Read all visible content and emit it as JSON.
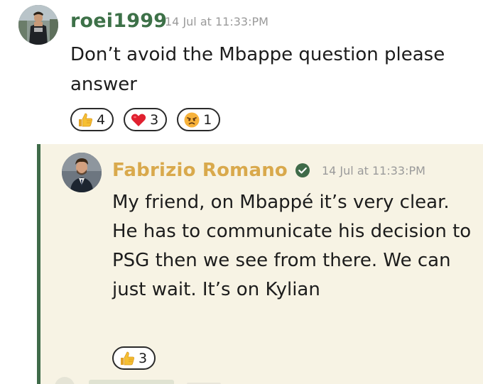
{
  "comment": {
    "username": "roei1999",
    "timestamp": "14 Jul at 11:33:PM",
    "text": "Don’t avoid the Mbappe question please answer",
    "reactions": [
      {
        "emoji": "thumbs-up",
        "count": "4"
      },
      {
        "emoji": "red-heart",
        "count": "3"
      },
      {
        "emoji": "angry-face",
        "count": "1"
      }
    ]
  },
  "reply": {
    "username": "Fabrizio Romano",
    "verified": true,
    "timestamp": "14 Jul at 11:33:PM",
    "text": "My friend, on Mbappé it’s very clear. He has to communicate his decision to PSG then we see from there. We can just wait. It’s on Kylian",
    "reactions": [
      {
        "emoji": "thumbs-up",
        "count": "3"
      }
    ]
  },
  "colors": {
    "commenter_name": "#3d7148",
    "reply_author_name": "#d9a94c",
    "reply_background": "#f7f3e4",
    "thread_line": "#3f6b49",
    "timestamp": "#9a9a9a"
  }
}
